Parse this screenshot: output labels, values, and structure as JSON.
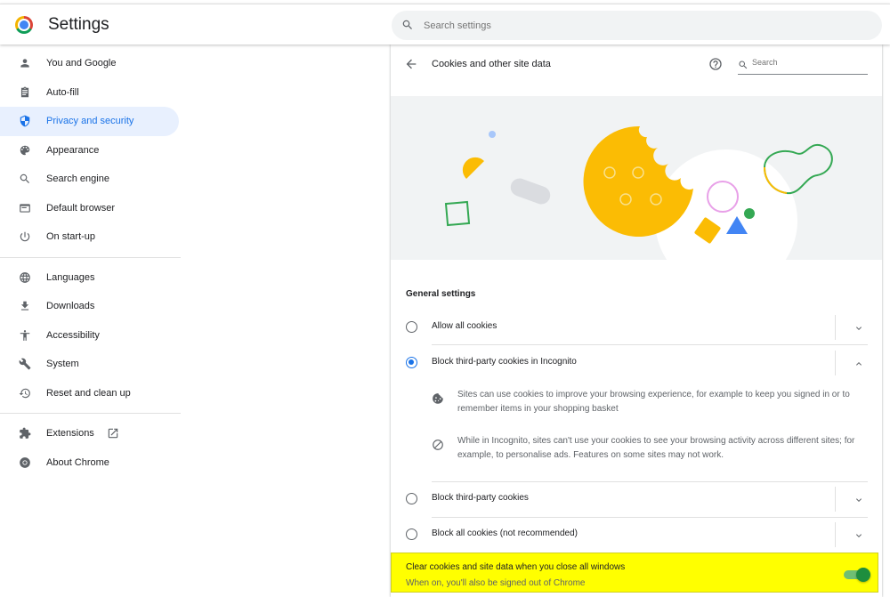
{
  "header": {
    "app_title": "Settings",
    "search_placeholder": "Search settings",
    "logo_icon": "chrome-logo-icon"
  },
  "sidebar": {
    "items": [
      {
        "label": "You and Google",
        "icon": "person-icon"
      },
      {
        "label": "Auto-fill",
        "icon": "clipboard-icon"
      },
      {
        "label": "Privacy and security",
        "icon": "shield-icon",
        "active": true
      },
      {
        "label": "Appearance",
        "icon": "palette-icon"
      },
      {
        "label": "Search engine",
        "icon": "search-icon"
      },
      {
        "label": "Default browser",
        "icon": "browser-icon"
      },
      {
        "label": "On start-up",
        "icon": "power-icon"
      },
      {
        "label": "Languages",
        "icon": "globe-icon"
      },
      {
        "label": "Downloads",
        "icon": "download-icon"
      },
      {
        "label": "Accessibility",
        "icon": "accessibility-icon"
      },
      {
        "label": "System",
        "icon": "wrench-icon"
      },
      {
        "label": "Reset and clean up",
        "icon": "restore-icon"
      },
      {
        "label": "Extensions",
        "icon": "puzzle-icon",
        "external": true
      },
      {
        "label": "About Chrome",
        "icon": "chrome-icon"
      }
    ],
    "external_icon": "open-in-new-icon"
  },
  "subpage": {
    "title": "Cookies and other site data",
    "search_placeholder": "Search",
    "section_title": "General settings",
    "options": [
      {
        "label": "Allow all cookies",
        "checked": false,
        "expanded": false
      },
      {
        "label": "Block third-party cookies in Incognito",
        "checked": true,
        "expanded": true
      },
      {
        "label": "Block third-party cookies",
        "checked": false,
        "expanded": false
      },
      {
        "label": "Block all cookies (not recommended)",
        "checked": false,
        "expanded": false
      }
    ],
    "details": [
      {
        "icon": "cookie-icon",
        "text": "Sites can use cookies to improve your browsing experience, for example to keep you signed in or to remember items in your shopping basket"
      },
      {
        "icon": "block-icon",
        "text": "While in Incognito, sites can't use your cookies to see your browsing activity across different sites; for example, to personalise ads. Features on some sites may not work."
      }
    ],
    "clear_on_exit": {
      "title": "Clear cookies and site data when you close all windows",
      "subtitle": "When on, you'll also be signed out of Chrome",
      "enabled": true
    }
  },
  "colors": {
    "accent": "#1a73e8",
    "active_nav_bg": "#e8f0fe",
    "highlight": "#ffff00",
    "toggle_on": "#1e8e3e",
    "cookie": "#fbbc04"
  }
}
